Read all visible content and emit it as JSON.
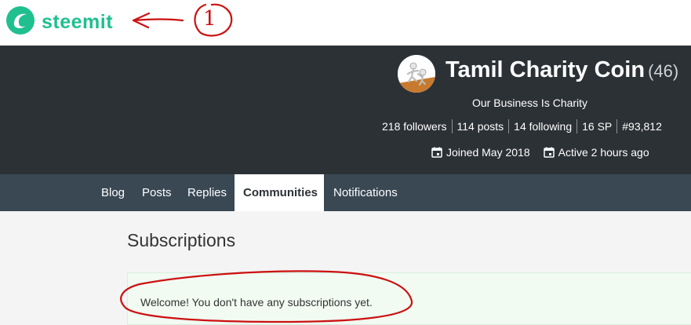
{
  "brand": {
    "logo_text": "steemit",
    "logo_color": "#1fbf8f",
    "logo_icon": "steemit-logo-icon"
  },
  "profile": {
    "name": "Tamil Charity Coin",
    "reputation": "(46)",
    "about": "Our Business Is Charity",
    "stats": [
      "218 followers",
      "114 posts",
      "14 following",
      "16 SP",
      "#93,812"
    ],
    "joined": "Joined May 2018",
    "active": "Active 2 hours ago",
    "avatar_icon": "avatar-figure-icon",
    "meta_icon": "calendar-icon"
  },
  "nav": {
    "tabs": [
      "Blog",
      "Posts",
      "Replies",
      "Communities",
      "Notifications"
    ],
    "active_tab": "Communities"
  },
  "subscriptions": {
    "title": "Subscriptions",
    "empty_message": "Welcome! You don't have any subscriptions yet."
  },
  "annotations": {
    "marker_text": "1",
    "color": "#cc1111"
  },
  "colors": {
    "banner_bg": "#2c3136",
    "nav_bg": "#3a4854",
    "content_bg": "#f4f4f4",
    "notice_bg": "#f1fbf2"
  }
}
